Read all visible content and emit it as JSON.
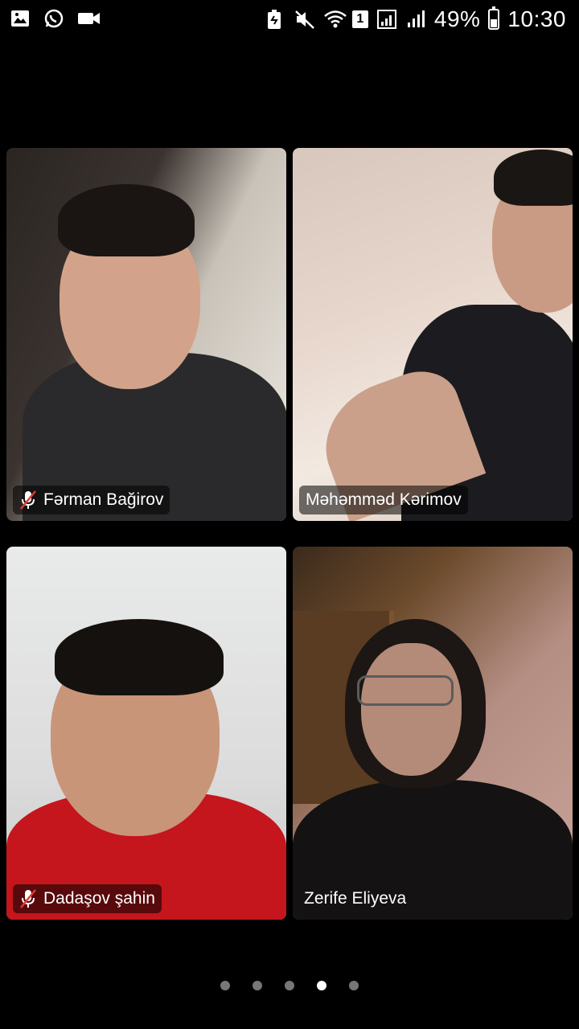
{
  "status_bar": {
    "left_icons": [
      "gallery-icon",
      "whatsapp-icon",
      "video-camera-icon"
    ],
    "right_icons": [
      "battery-saver-icon",
      "mute-icon",
      "wifi-icon",
      "sim-icon",
      "signal-icon",
      "signal-icon"
    ],
    "sim_label": "1",
    "battery": "49%",
    "battery_level": 0.49,
    "time": "10:30"
  },
  "participants": [
    {
      "name": "Fərman Bağirov",
      "muted": true
    },
    {
      "name": "Məhəmməd Kərimov",
      "muted": false
    },
    {
      "name": "Dadaşov şahin",
      "muted": true
    },
    {
      "name": "Zerife Eliyeva",
      "muted": false
    }
  ],
  "pagination": {
    "total": 5,
    "active_index": 3
  },
  "colors": {
    "background": "#000000",
    "mute_slash": "#e53935",
    "dot_inactive": "#777777",
    "dot_active": "#ffffff"
  }
}
